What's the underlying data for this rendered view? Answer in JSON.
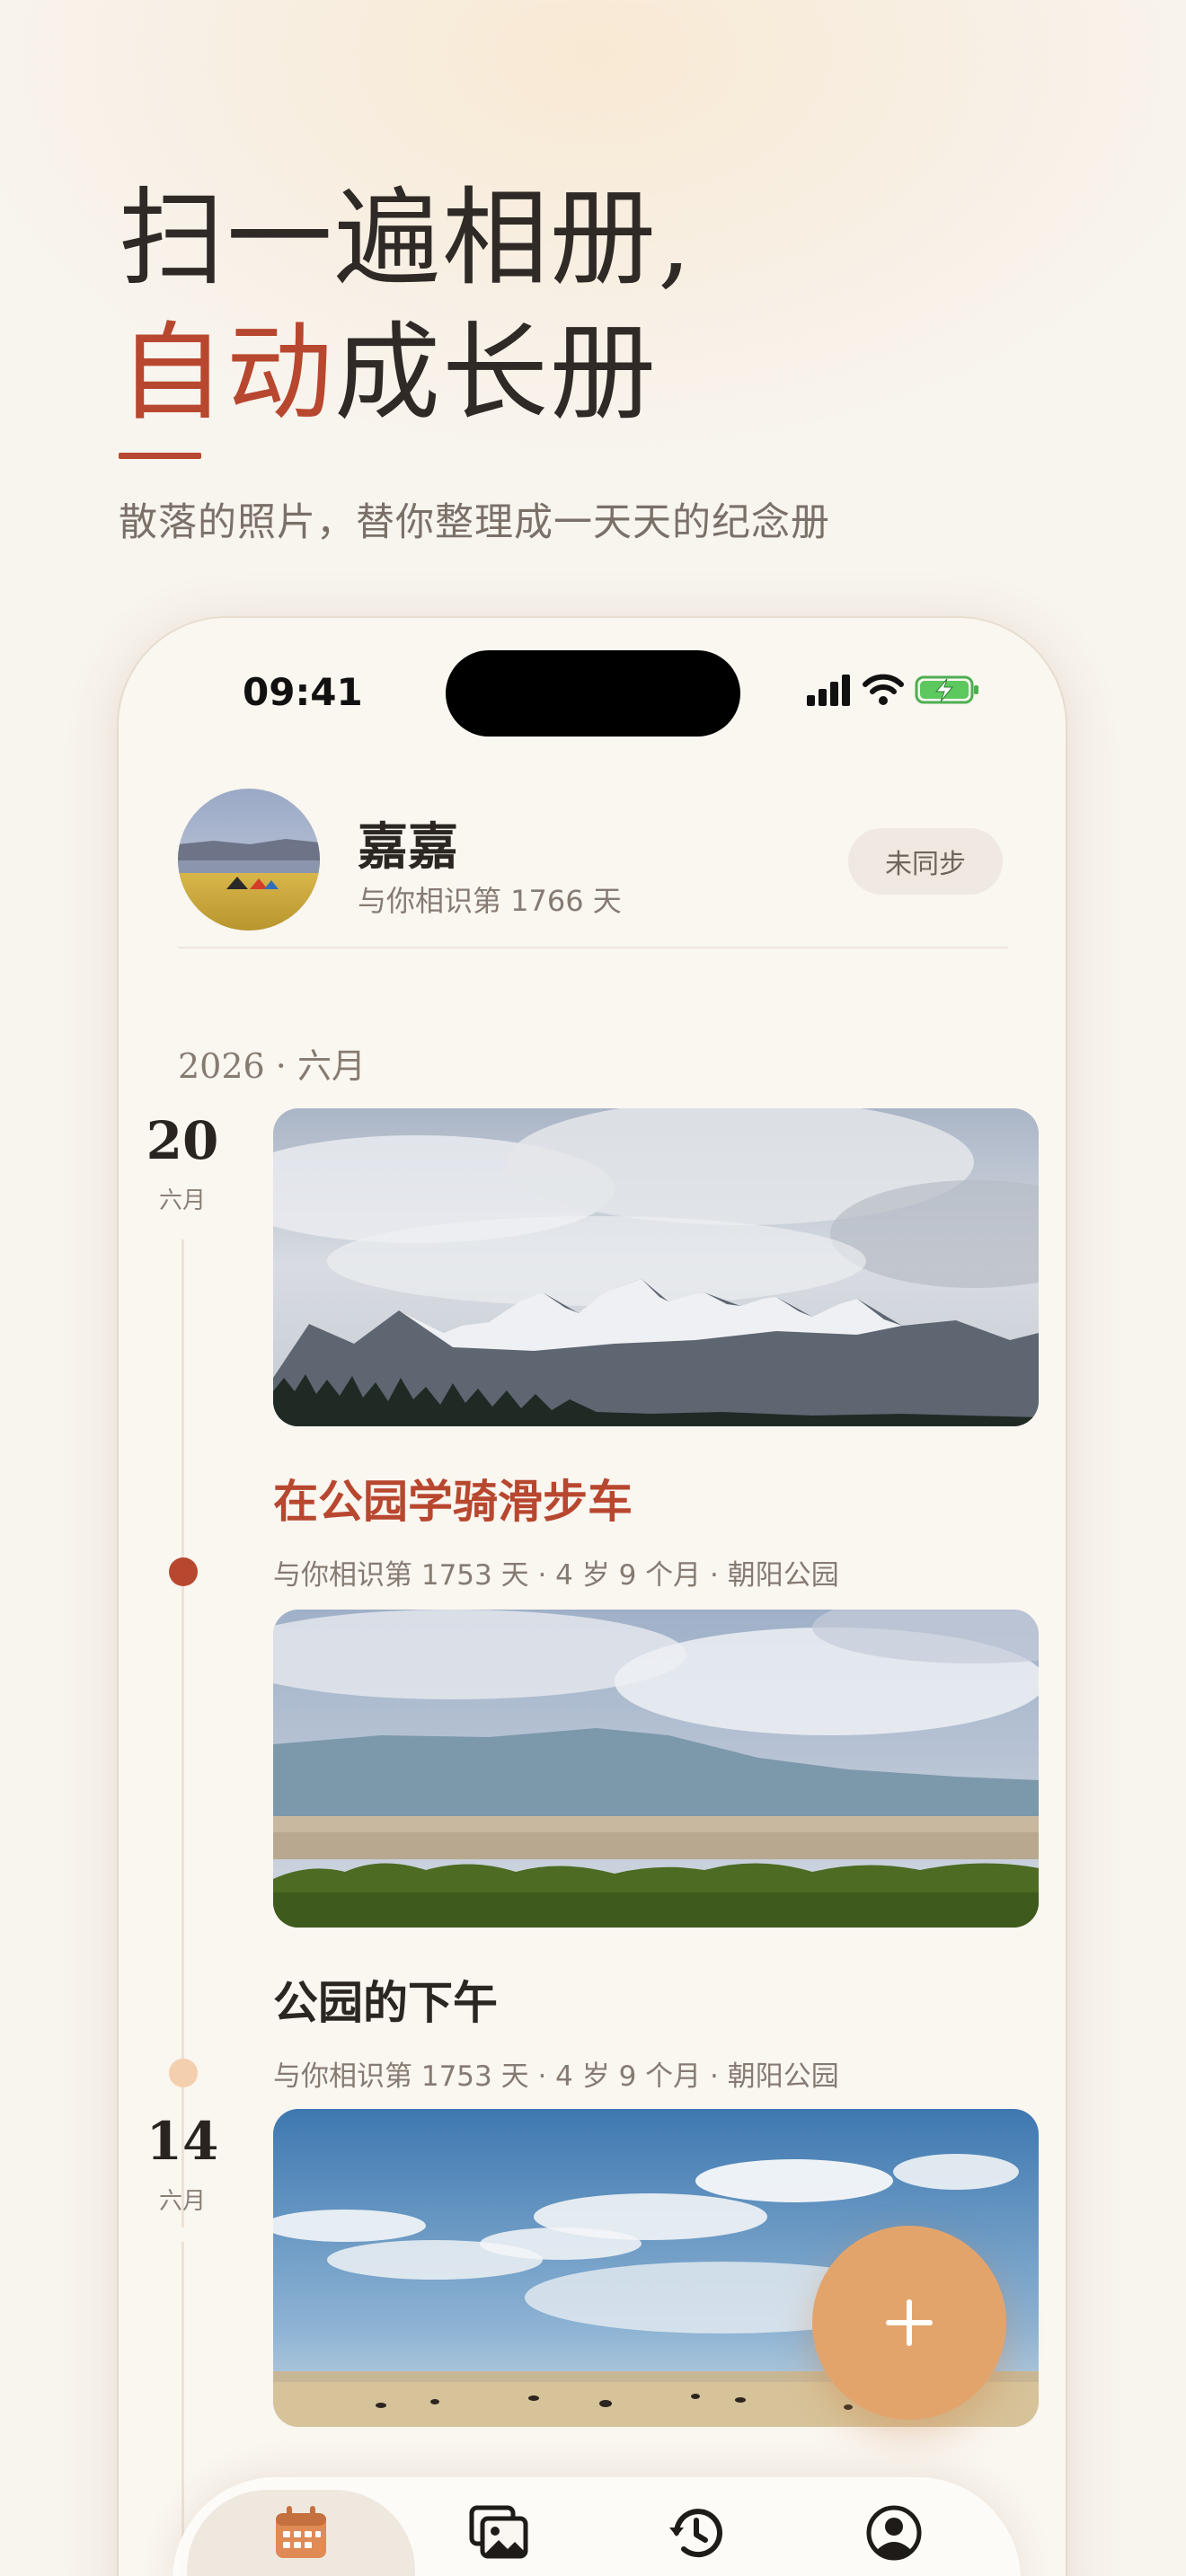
{
  "hero": {
    "line1": "扫一遍相册,",
    "line2_accent": "自动",
    "line2_rest": "成长册",
    "subtitle": "散落的照片，替你整理成一天天的纪念册"
  },
  "status_bar": {
    "time": "09:41"
  },
  "profile": {
    "name": "嘉嘉",
    "subtitle": "与你相识第 1766 天",
    "sync_label": "未同步"
  },
  "timeline": {
    "month_header": "2026 · 六月",
    "days": [
      {
        "day": "20",
        "month": "六月"
      },
      {
        "day": "14",
        "month": "六月"
      }
    ],
    "entries": [
      {
        "title": "在公园学骑滑步车",
        "meta": "与你相识第 1753 天 · 4 岁 9 个月 · 朝阳公园",
        "photo": "snowy-mountains"
      },
      {
        "title": "公园的下午",
        "meta": "与你相识第 1753 天 · 4 岁 9 个月 · 朝阳公园",
        "photo": "grassland-hills"
      },
      {
        "title": "",
        "meta": "",
        "photo": "blue-sky-prairie"
      }
    ]
  },
  "fab": {
    "icon": "plus-icon"
  },
  "tab_bar": {
    "tabs": [
      {
        "label": "",
        "icon": "calendar-icon",
        "active": true
      },
      {
        "label": "",
        "icon": "photos-icon",
        "active": false
      },
      {
        "label": "",
        "icon": "history-icon",
        "active": false
      },
      {
        "label": "",
        "icon": "profile-icon",
        "active": false
      }
    ]
  },
  "colors": {
    "accent": "#b8472f",
    "fab": "#e3a46c",
    "background": "#f8f4ee",
    "card": "#faf6f0"
  }
}
